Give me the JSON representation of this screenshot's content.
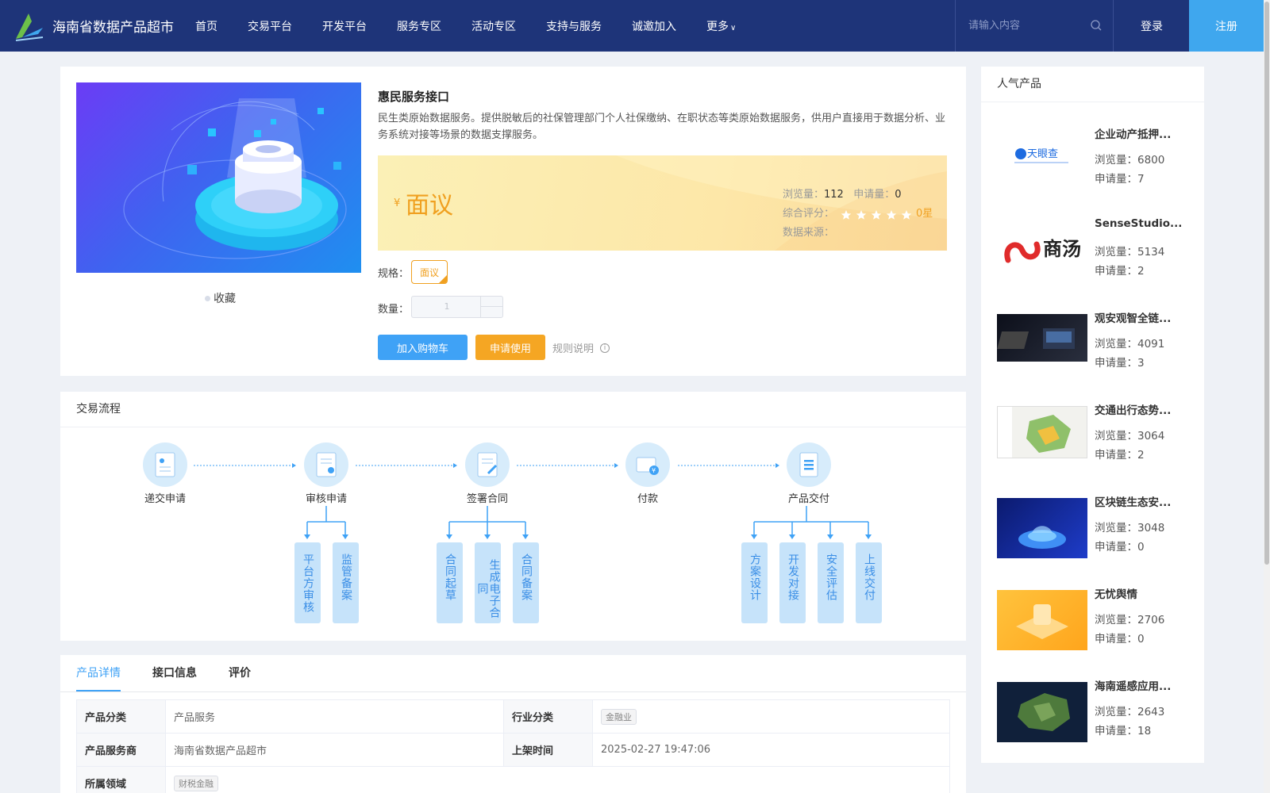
{
  "nav": {
    "brand": "海南省数据产品超市",
    "items": [
      "首页",
      "交易平台",
      "开发平台",
      "服务专区",
      "活动专区",
      "支持与服务",
      "诚邀加入",
      "更多"
    ],
    "search_placeholder": "请输入内容",
    "login": "登录",
    "register": "注册",
    "colors": {
      "bg": "#1e3479",
      "register_bg": "#3fa7ee"
    }
  },
  "product": {
    "title": "惠民服务接口",
    "description": "民生类原始数据服务。提供脱敏后的社保管理部门个人社保缴纳、在职状态等类原始数据服务，供用户直接用于数据分析、业务系统对接等场景的数据支撑服务。",
    "favorite": "收藏",
    "currency": "¥",
    "price": "面议",
    "views_label": "浏览量：",
    "views": "112",
    "applies_label": "申请量：",
    "applies": "0",
    "rating_label": "综合评分：",
    "rating_stars": 0,
    "rating_text": "0星",
    "source_label": "数据来源：",
    "spec_label": "规格：",
    "spec_value": "面议",
    "qty_label": "数量：",
    "qty_value": "1",
    "add_cart": "加入购物车",
    "apply": "申请使用",
    "rules": "规则说明"
  },
  "flow": {
    "title": "交易流程",
    "steps": [
      {
        "label": "递交申请",
        "icon": "document-user-icon",
        "subs": []
      },
      {
        "label": "审核申请",
        "icon": "review-icon",
        "subs": [
          "平台方审核",
          "监管备案"
        ]
      },
      {
        "label": "签署合同",
        "icon": "contract-sign-icon",
        "subs": [
          "合同起草",
          "生成电子合同",
          "合同备案"
        ]
      },
      {
        "label": "付款",
        "icon": "payment-icon",
        "subs": []
      },
      {
        "label": "产品交付",
        "icon": "delivery-icon",
        "subs": [
          "方案设计",
          "开发对接",
          "安全评估",
          "上线交付"
        ]
      }
    ]
  },
  "details": {
    "tabs": [
      "产品详情",
      "接口信息",
      "评价"
    ],
    "active_tab": 0,
    "rows": [
      {
        "k1": "产品分类",
        "v1": "产品服务",
        "k2": "行业分类",
        "v2": "金融业"
      },
      {
        "k1": "产品服务商",
        "v1": "海南省数据产品超市",
        "k2": "上架时间",
        "v2": "2025-02-27 19:47:06"
      },
      {
        "k1": "所属领域",
        "v1": "财税金融"
      }
    ]
  },
  "popular": {
    "title": "人气产品",
    "views_label": "浏览量：",
    "applies_label": "申请量：",
    "items": [
      {
        "name": "企业动产抵押...",
        "views": "6800",
        "applies": "7",
        "thumb_text": "天眼查"
      },
      {
        "name": "SenseStudio...",
        "views": "5134",
        "applies": "2",
        "thumb_text": "商汤"
      },
      {
        "name": "观安观智全链...",
        "views": "4091",
        "applies": "3"
      },
      {
        "name": "交通出行态势...",
        "views": "3064",
        "applies": "2"
      },
      {
        "name": "区块链生态安...",
        "views": "3048",
        "applies": "0"
      },
      {
        "name": "无忧舆情",
        "views": "2706",
        "applies": "0"
      },
      {
        "name": "海南遥感应用...",
        "views": "2643",
        "applies": "18"
      }
    ]
  }
}
